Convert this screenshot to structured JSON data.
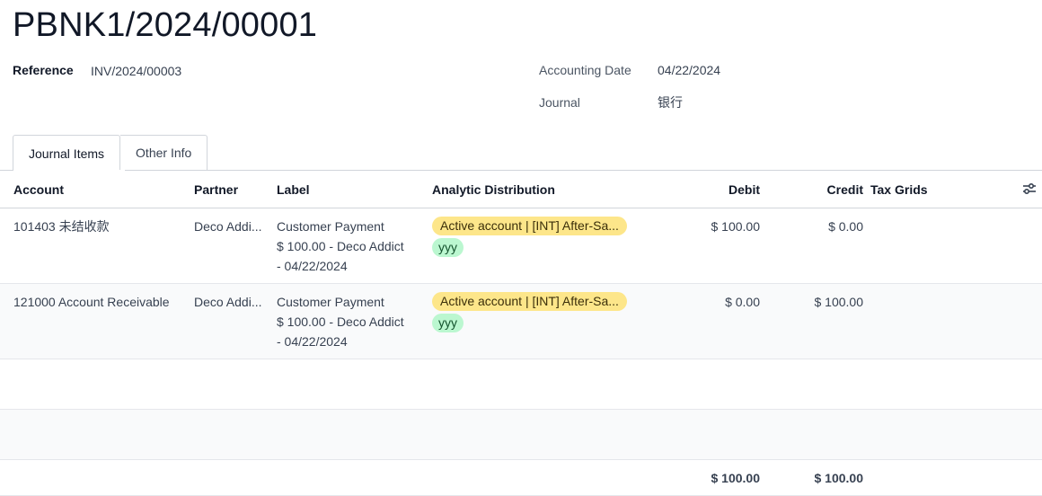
{
  "record": {
    "title": "PBNK1/2024/00001",
    "reference_label": "Reference",
    "reference_value": "INV/2024/00003",
    "accounting_date_label": "Accounting Date",
    "accounting_date_value": "04/22/2024",
    "journal_label": "Journal",
    "journal_value": "银行"
  },
  "tabs": [
    {
      "label": "Journal Items",
      "active": true
    },
    {
      "label": "Other Info",
      "active": false
    }
  ],
  "table": {
    "columns": [
      "Account",
      "Partner",
      "Label",
      "Analytic Distribution",
      "Debit",
      "Credit",
      "Tax Grids"
    ],
    "settings_icon": "sliders-icon",
    "rows": [
      {
        "account": "101403 未结收款",
        "partner": "Deco Addi...",
        "label_line1": "Customer Payment",
        "label_line2": "$ 100.00 - Deco Addict",
        "label_line3": "- 04/22/2024",
        "analytic_tag": "Active account | [INT] After-Sa...",
        "analytic_tag2": "yyy",
        "debit": "$ 100.00",
        "credit": "$ 0.00",
        "tax_grids": ""
      },
      {
        "account": "121000 Account Receivable",
        "partner": "Deco Addi...",
        "label_line1": "Customer Payment",
        "label_line2": "$ 100.00 - Deco Addict",
        "label_line3": "- 04/22/2024",
        "analytic_tag": "Active account | [INT] After-Sa...",
        "analytic_tag2": "yyy",
        "debit": "$ 0.00",
        "credit": "$ 100.00",
        "tax_grids": ""
      }
    ],
    "totals": {
      "debit": "$ 100.00",
      "credit": "$ 100.00"
    }
  },
  "colors": {
    "analytic_tag_bg": "#fde68a",
    "secondary_tag_bg": "#bbf7d0",
    "border": "#d1d5db"
  }
}
